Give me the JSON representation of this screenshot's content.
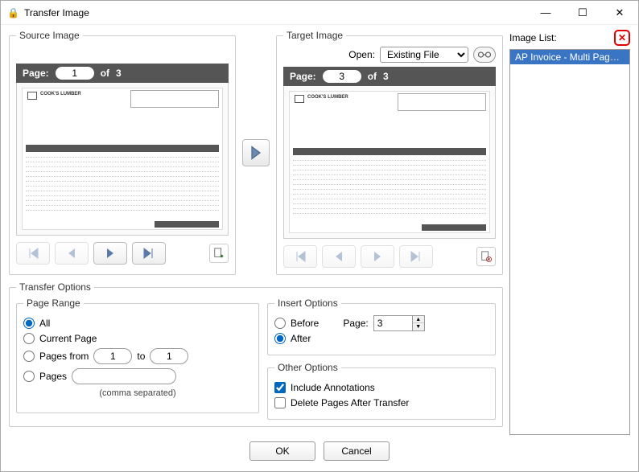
{
  "window": {
    "title": "Transfer Image"
  },
  "source": {
    "legend": "Source Image",
    "page_label": "Page:",
    "page_current": "1",
    "of_label": "of",
    "page_total": "3",
    "doc_company": "COOK'S LUMBER"
  },
  "target": {
    "legend": "Target Image",
    "open_label": "Open:",
    "open_value": "Existing File",
    "page_label": "Page:",
    "page_current": "3",
    "of_label": "of",
    "page_total": "3",
    "doc_company": "COOK'S LUMBER"
  },
  "transfer_options": {
    "legend": "Transfer Options",
    "page_range": {
      "legend": "Page Range",
      "all": "All",
      "current": "Current Page",
      "pages_from": "Pages from",
      "from_value": "1",
      "to_label": "to",
      "to_value": "1",
      "pages": "Pages",
      "pages_value": "",
      "comma_note": "(comma separated)"
    },
    "insert_options": {
      "legend": "Insert Options",
      "before": "Before",
      "after": "After",
      "page_label": "Page:",
      "page_value": "3"
    },
    "other_options": {
      "legend": "Other Options",
      "include_annotations": "Include Annotations",
      "delete_after": "Delete Pages After Transfer"
    }
  },
  "image_list": {
    "label": "Image List:",
    "items": [
      "AP Invoice - Multi Page.pdf"
    ]
  },
  "buttons": {
    "ok": "OK",
    "cancel": "Cancel"
  }
}
